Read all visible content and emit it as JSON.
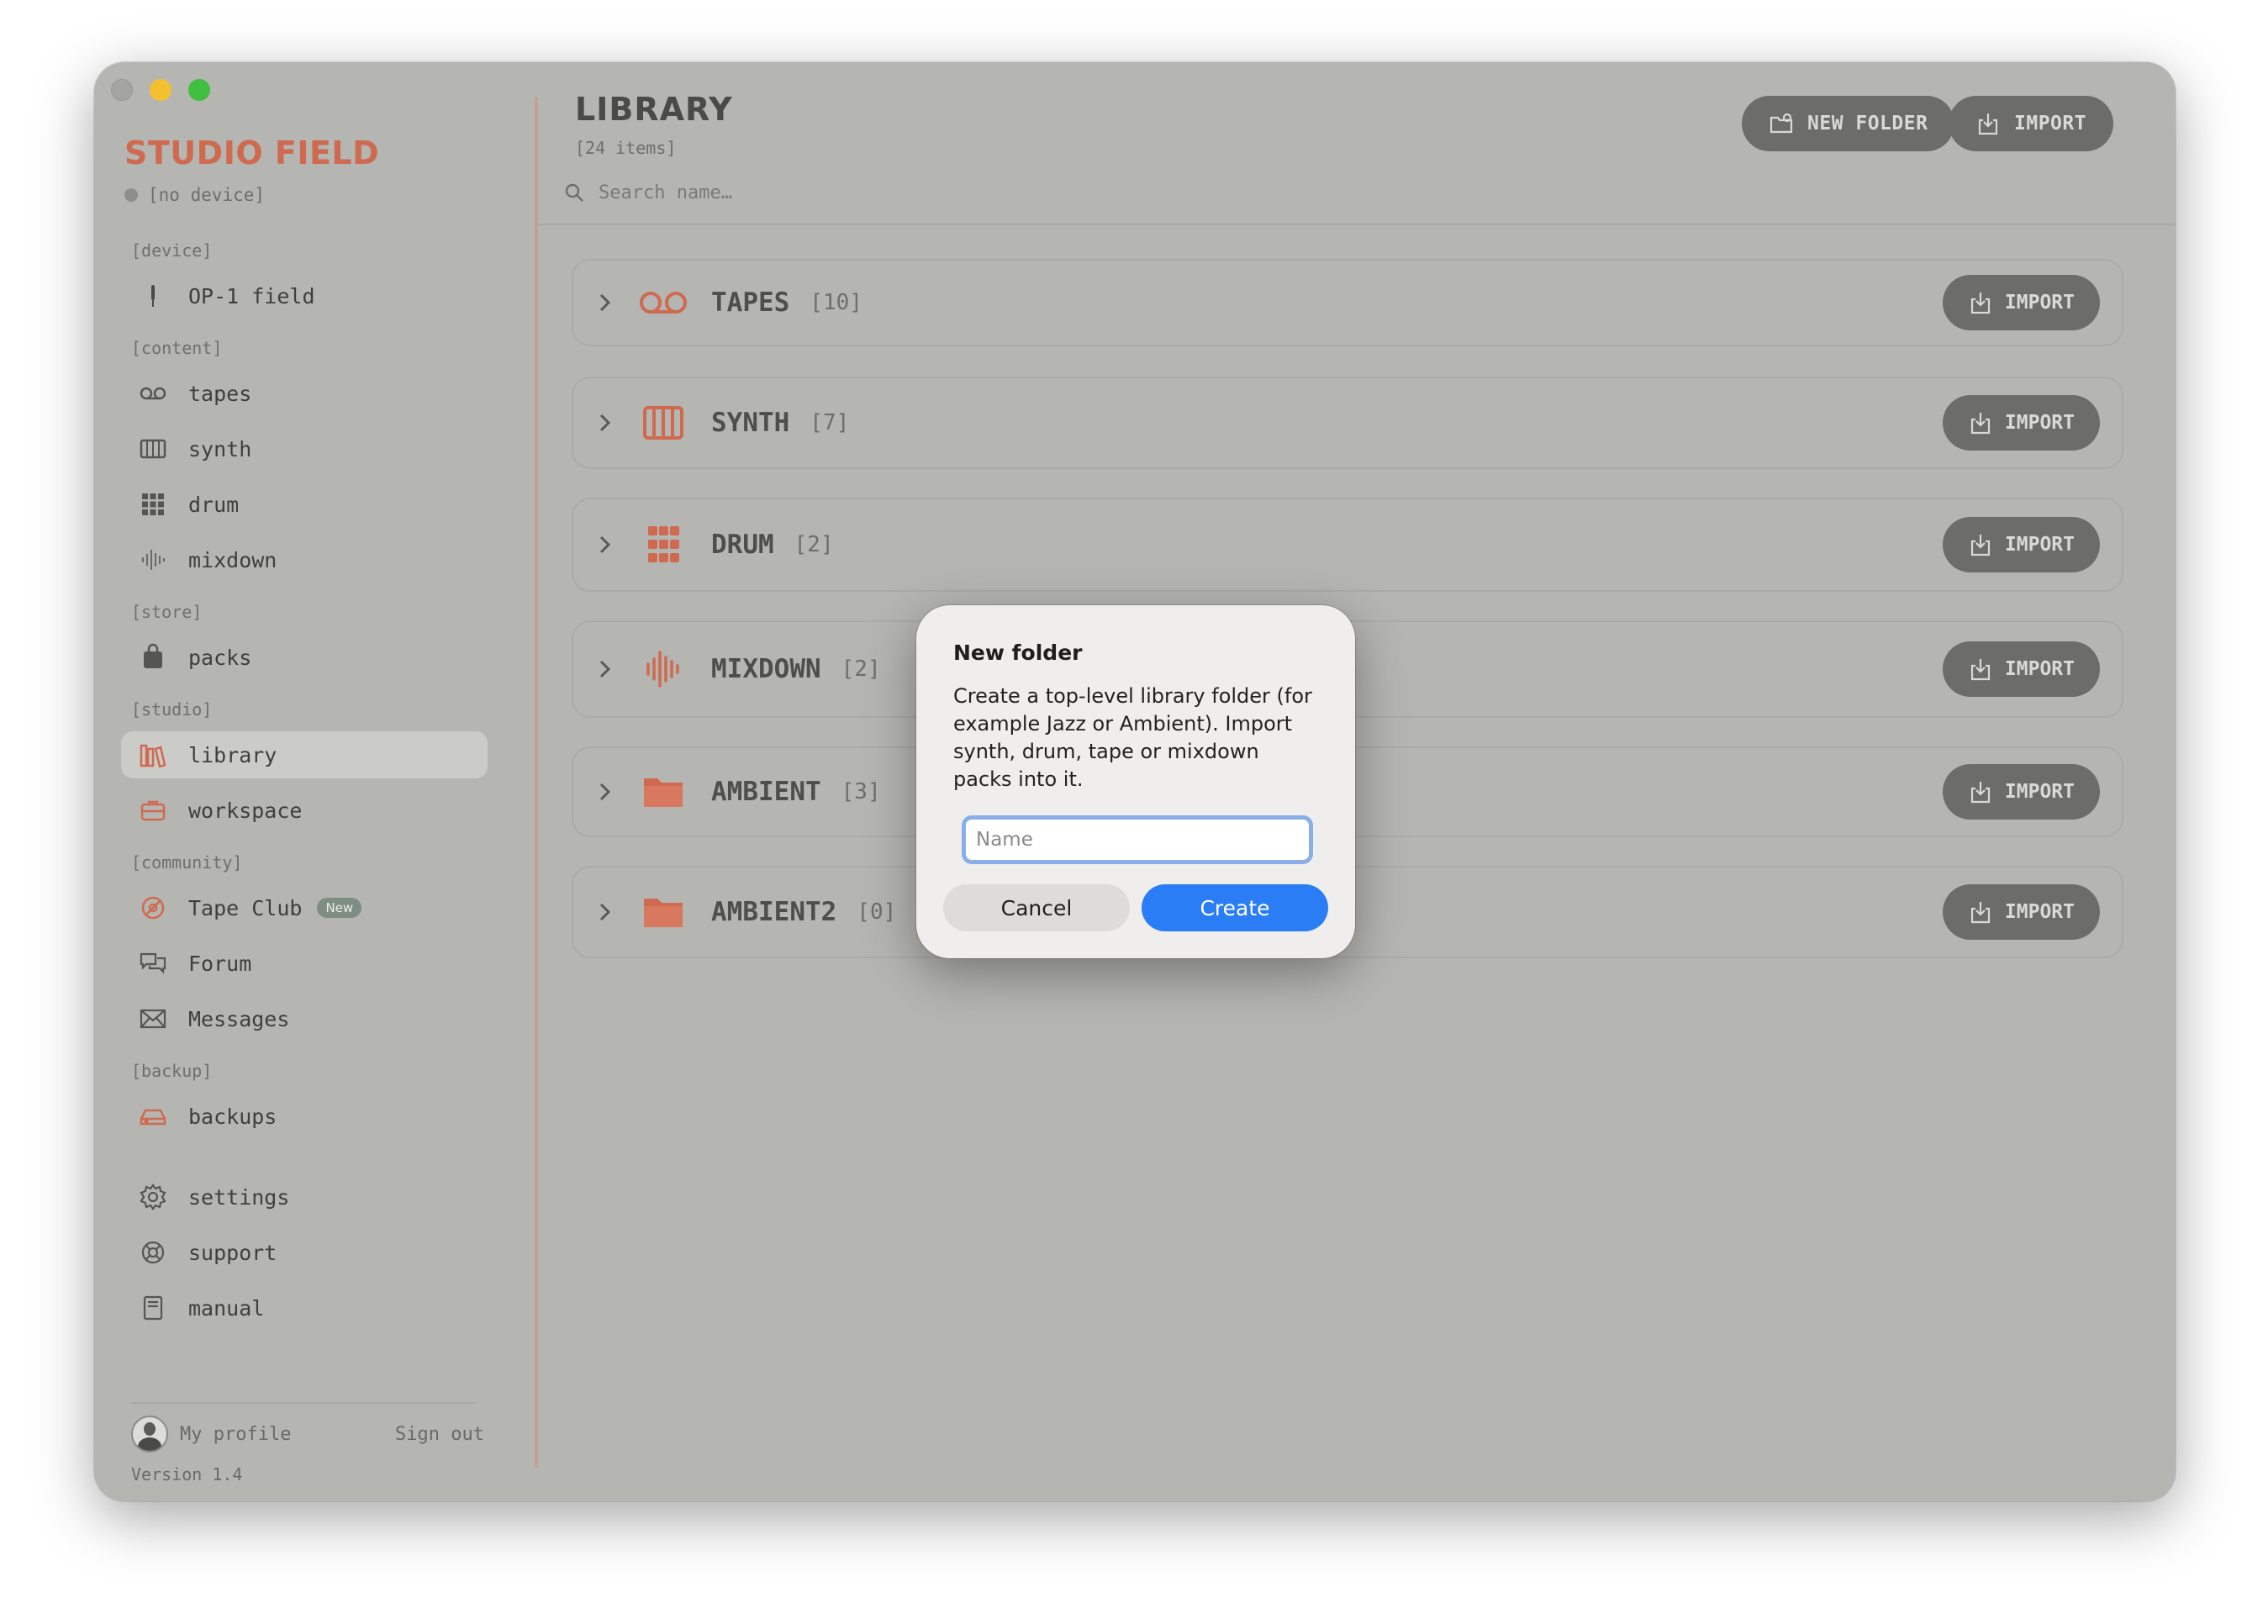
{
  "app": {
    "brand": "STUDIO FIELD",
    "device_status": "[no device]",
    "version": "Version 1.4"
  },
  "sidebar": {
    "sections": {
      "device": "[device]",
      "content": "[content]",
      "store": "[store]",
      "studio": "[studio]",
      "community": "[community]",
      "backup": "[backup]"
    },
    "items": {
      "op1": "OP-1 field",
      "tapes": "tapes",
      "synth": "synth",
      "drum": "drum",
      "mixdown": "mixdown",
      "packs": "packs",
      "library": "library",
      "workspace": "workspace",
      "tapeclub": "Tape Club",
      "tapeclub_badge": "New",
      "forum": "Forum",
      "messages": "Messages",
      "backups": "backups",
      "settings": "settings",
      "support": "support",
      "manual": "manual"
    },
    "profile": "My profile",
    "signout": "Sign out"
  },
  "library": {
    "title": "LIBRARY",
    "count": "[24 items]",
    "new_folder": "NEW FOLDER",
    "import": "IMPORT",
    "search_placeholder": "Search name…",
    "rows": [
      {
        "name": "TAPES",
        "count": "[10]",
        "import": "IMPORT",
        "icon": "tape-icon"
      },
      {
        "name": "SYNTH",
        "count": "[7]",
        "import": "IMPORT",
        "icon": "keyboard-icon"
      },
      {
        "name": "DRUM",
        "count": "[2]",
        "import": "IMPORT",
        "icon": "drum-grid-icon"
      },
      {
        "name": "MIXDOWN",
        "count": "[2]",
        "import": "IMPORT",
        "icon": "waveform-icon"
      },
      {
        "name": "AMBIENT",
        "count": "[3]",
        "import": "IMPORT",
        "icon": "folder-icon"
      },
      {
        "name": "AMBIENT2",
        "count": "[0]",
        "import": "IMPORT",
        "icon": "folder-icon"
      }
    ]
  },
  "dialog": {
    "title": "New folder",
    "body": "Create a top-level library folder (for example Jazz or Ambient). Import synth, drum, tape or mixdown packs into it.",
    "input_placeholder": "Name",
    "input_value": "",
    "cancel": "Cancel",
    "create": "Create"
  },
  "colors": {
    "accent": "#cf6a50",
    "primary_button": "#2a7df4",
    "dim_bg": "#b5b5b1"
  }
}
